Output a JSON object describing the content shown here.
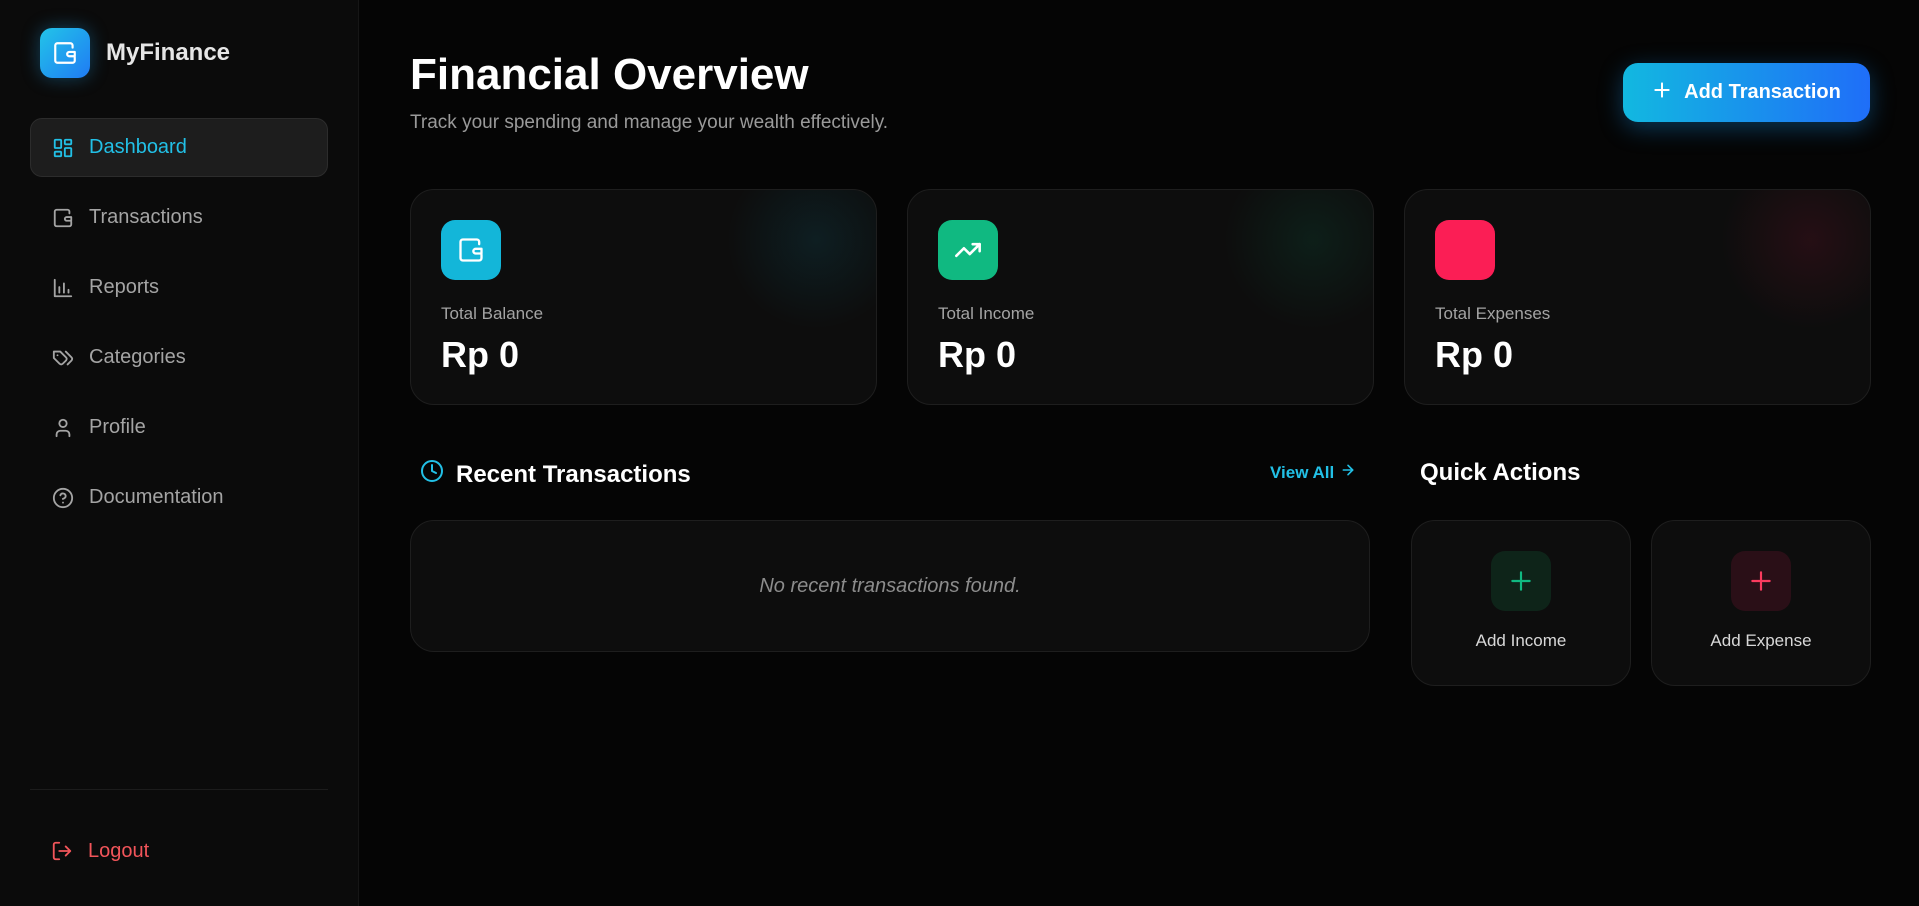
{
  "brand": {
    "name": "MyFinance"
  },
  "sidebar": {
    "items": [
      {
        "label": "Dashboard",
        "icon": "layout-grid-icon",
        "active": true
      },
      {
        "label": "Transactions",
        "icon": "wallet-icon"
      },
      {
        "label": "Reports",
        "icon": "bar-chart-icon"
      },
      {
        "label": "Categories",
        "icon": "tags-icon"
      },
      {
        "label": "Profile",
        "icon": "user-icon"
      },
      {
        "label": "Documentation",
        "icon": "help-circle-icon"
      }
    ],
    "logout_label": "Logout"
  },
  "header": {
    "title": "Financial Overview",
    "subtitle": "Track your spending and manage your wealth effectively.",
    "add_button_label": "Add Transaction"
  },
  "stats": [
    {
      "label": "Total Balance",
      "value": "Rp 0",
      "icon": "wallet-icon",
      "color": "#13b6d9"
    },
    {
      "label": "Total Income",
      "value": "Rp 0",
      "icon": "trending-up-icon",
      "color": "#10b981"
    },
    {
      "label": "Total Expenses",
      "value": "Rp 0",
      "icon": "trending-down-icon",
      "color": "#fb1e55"
    }
  ],
  "recent": {
    "title": "Recent Transactions",
    "view_all_label": "View All",
    "empty_text": "No recent transactions found."
  },
  "quick_actions": {
    "title": "Quick Actions",
    "items": [
      {
        "label": "Add Income",
        "icon": "plus-icon",
        "color": "#10b981"
      },
      {
        "label": "Add Expense",
        "icon": "plus-icon",
        "color": "#fb3b5e"
      }
    ]
  },
  "colors": {
    "accent": "#22c0e6",
    "background": "#050505",
    "danger": "#f2555a"
  }
}
